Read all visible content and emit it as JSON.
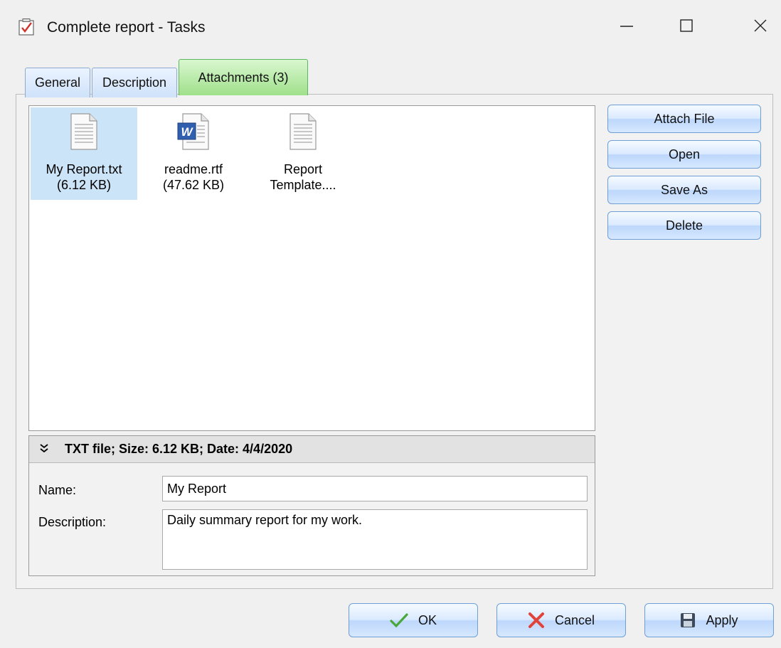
{
  "window": {
    "title": "Complete report  - Tasks"
  },
  "tabs": [
    {
      "label": "General"
    },
    {
      "label": "Description"
    },
    {
      "label": "Attachments (3)"
    }
  ],
  "files": [
    {
      "name": "My Report.txt",
      "size": "(6.12 KB)",
      "icon": "text-file-icon",
      "selected": true
    },
    {
      "name": "readme.rtf",
      "size": "(47.62 KB)",
      "icon": "word-document-icon",
      "selected": false
    },
    {
      "name": "Report",
      "size": "Template....",
      "icon": "text-file-icon",
      "selected": false
    }
  ],
  "details": {
    "summary": "TXT file;  Size: 6.12 KB;  Date: 4/4/2020",
    "name_label": "Name:",
    "name_value": "My Report",
    "description_label": "Description:",
    "description_value": "Daily summary report for my work."
  },
  "side_buttons": {
    "attach": "Attach File",
    "open": "Open",
    "save_as": "Save As",
    "delete": "Delete"
  },
  "footer_buttons": {
    "ok": "OK",
    "cancel": "Cancel",
    "apply": "Apply"
  },
  "colors": {
    "active_tab": "#9fe08a",
    "selection": "#cce4f7",
    "button_border": "#6e9fd6"
  }
}
